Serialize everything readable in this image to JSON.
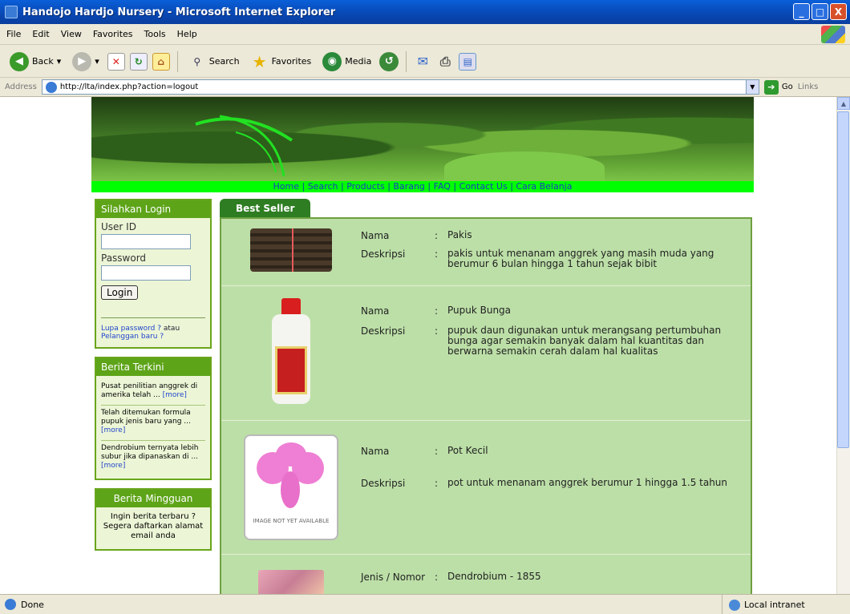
{
  "window": {
    "title": "Handojo Hardjo Nursery - Microsoft Internet Explorer",
    "minimize": "_",
    "maximize": "□",
    "close": "X"
  },
  "menu": [
    "File",
    "Edit",
    "View",
    "Favorites",
    "Tools",
    "Help"
  ],
  "toolbar": {
    "back": "Back",
    "search": "Search",
    "favorites": "Favorites",
    "media": "Media"
  },
  "address": {
    "label": "Address",
    "url": "http://lta/index.php?action=logout",
    "go": "Go",
    "links": "Links"
  },
  "nav": [
    "Home",
    "Search",
    "Products",
    "Barang",
    "FAQ",
    "Contact Us",
    "Cara Belanja"
  ],
  "login": {
    "title": "Silahkan Login",
    "user_label": "User ID",
    "user_value": "",
    "pass_label": "Password",
    "pass_value": "",
    "button": "Login",
    "forgot": "Lupa password ?",
    "or": "atau",
    "new_customer": "Pelanggan baru ?"
  },
  "news": {
    "title": "Berita Terkini",
    "more": "[more]",
    "items": [
      {
        "text": "Pusat penilitian anggrek di amerika telah ..."
      },
      {
        "text": "Telah ditemukan formula pupuk jenis baru yang ..."
      },
      {
        "text": "Dendrobium ternyata lebih subur jika dipanaskan di ..."
      }
    ]
  },
  "weekly": {
    "title": "Berita Mingguan",
    "text": "Ingin berita terbaru ? Segera daftarkan alamat email anda"
  },
  "bestseller": {
    "tab": "Best Seller",
    "label_nama": "Nama",
    "label_desc": "Deskripsi",
    "label_jenis": "Jenis / Nomor",
    "colon": ":",
    "products": [
      {
        "nama": "Pakis",
        "desc": "pakis untuk menanam anggrek yang masih muda yang berumur 6 bulan hingga 1 tahun sejak bibit"
      },
      {
        "nama": "Pupuk Bunga",
        "desc": "pupuk daun digunakan untuk merangsang pertumbuhan bunga agar semakin banyak dalam hal kuantitas dan berwarna semakin cerah dalam hal kualitas"
      },
      {
        "nama": "Pot Kecil",
        "desc": "pot untuk menanam anggrek berumur 1 hingga 1.5 tahun",
        "img_text": "IMAGE NOT YET AVAILABLE"
      },
      {
        "jenis": "Dendrobium - 1855"
      }
    ]
  },
  "status": {
    "left": "Done",
    "zone": "Local intranet"
  }
}
